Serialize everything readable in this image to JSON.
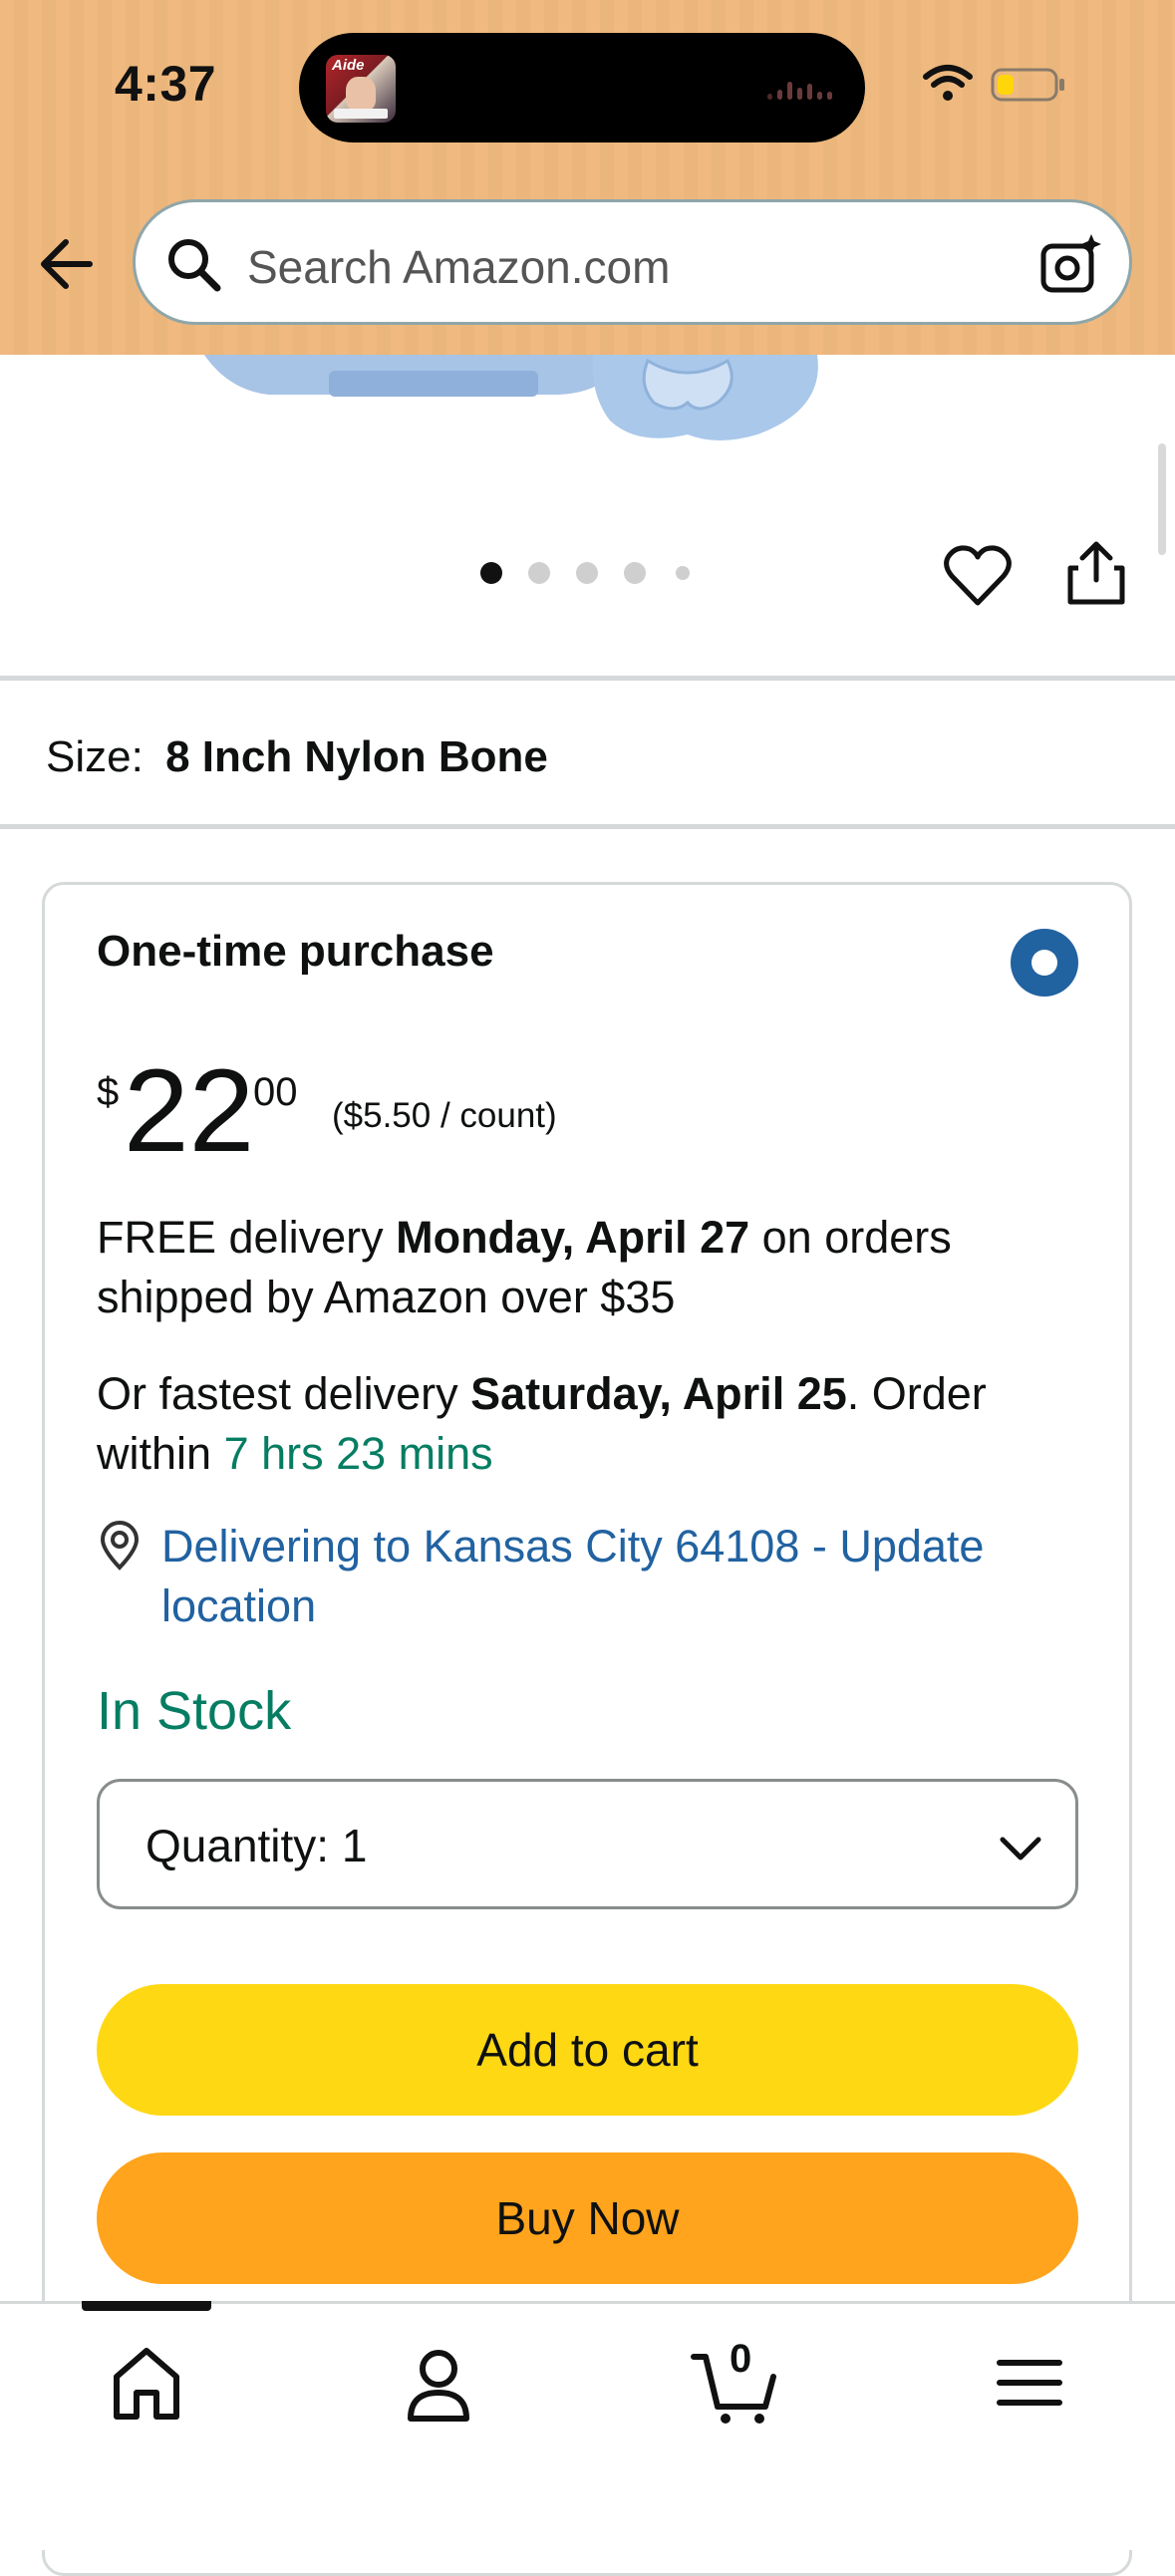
{
  "status_bar": {
    "time": "4:37",
    "album_art_text": "Aide"
  },
  "header": {
    "search_placeholder": "Search Amazon.com",
    "icons": [
      "back-arrow-icon",
      "search-icon",
      "camera-icon"
    ]
  },
  "gallery": {
    "image_count": 5,
    "active_index": 0
  },
  "size": {
    "label": "Size:",
    "value": "8 Inch Nylon Bone"
  },
  "purchase": {
    "title": "One-time purchase",
    "selected": true,
    "price": {
      "currency": "$",
      "whole": "22",
      "fraction": "00"
    },
    "unit_price": "($5.50 / count)",
    "free_delivery": {
      "prefix": "FREE delivery ",
      "date": "Monday, April 27",
      "suffix": " on orders shipped by Amazon over $35"
    },
    "fastest_delivery": {
      "prefix": "Or fastest delivery ",
      "date": "Saturday, April 25",
      "middle": ". Order within ",
      "countdown": "7 hrs 23 mins"
    },
    "location_link": "Delivering to Kansas City 64108 - Update location",
    "stock_status": "In Stock",
    "quantity_label": "Quantity:",
    "quantity_value": "1",
    "add_to_cart": "Add to cart",
    "buy_now": "Buy Now"
  },
  "bottom_nav": {
    "items": [
      "home-icon",
      "account-icon",
      "cart-icon",
      "menu-icon"
    ],
    "cart_count": "0",
    "active": "home-icon"
  },
  "colors": {
    "header_bg": "#efb97f",
    "link_blue": "#2162a1",
    "stock_green": "#067d62",
    "add_to_cart": "#ffd814",
    "buy_now": "#ffa41c"
  }
}
